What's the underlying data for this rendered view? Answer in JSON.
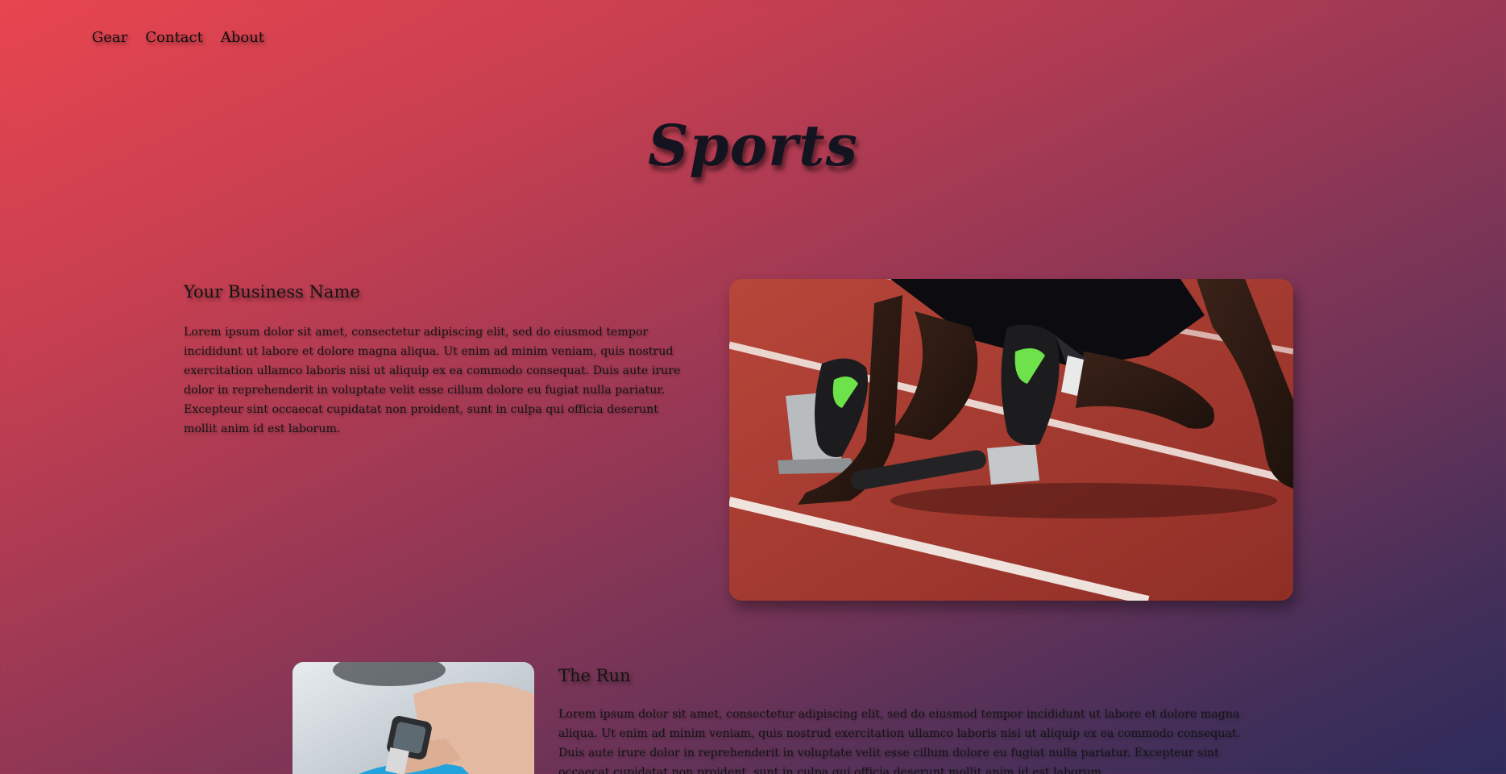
{
  "nav": {
    "items": [
      "Gear",
      "Contact",
      "About"
    ]
  },
  "hero": {
    "title": "Sports"
  },
  "section1": {
    "heading": "Your Business Name",
    "body": "Lorem ipsum dolor sit amet, consectetur adipiscing elit, sed do eiusmod tempor incididunt ut labore et dolore magna aliqua. Ut enim ad minim veniam, quis nostrud exercitation ullamco laboris nisi ut aliquip ex ea commodo consequat. Duis aute irure dolor in reprehenderit in voluptate velit esse cillum dolore eu fugiat nulla pariatur. Excepteur sint occaecat cupidatat non proident, sunt in culpa qui officia deserunt mollit anim id est laborum.",
    "image": "sprinter-starting-blocks-photo"
  },
  "section2": {
    "heading": "The Run",
    "body": "Lorem ipsum dolor sit amet, consectetur adipiscing elit, sed do eiusmod tempor incididunt ut labore et dolore magna aliqua. Ut enim ad minim veniam, quis nostrud exercitation ullamco laboris nisi ut aliquip ex ea commodo consequat. Duis aute irure dolor in reprehenderit in voluptate velit esse cillum dolore eu fugiat nulla pariatur. Excepteur sint occaecat cupidatat non proident, sunt in culpa qui officia deserunt mollit anim id est laborum.",
    "image": "smartwatch-wrist-photo"
  },
  "colors": {
    "gradient_start": "#e8454f",
    "gradient_end": "#2d2b5b",
    "text": "#141414"
  }
}
